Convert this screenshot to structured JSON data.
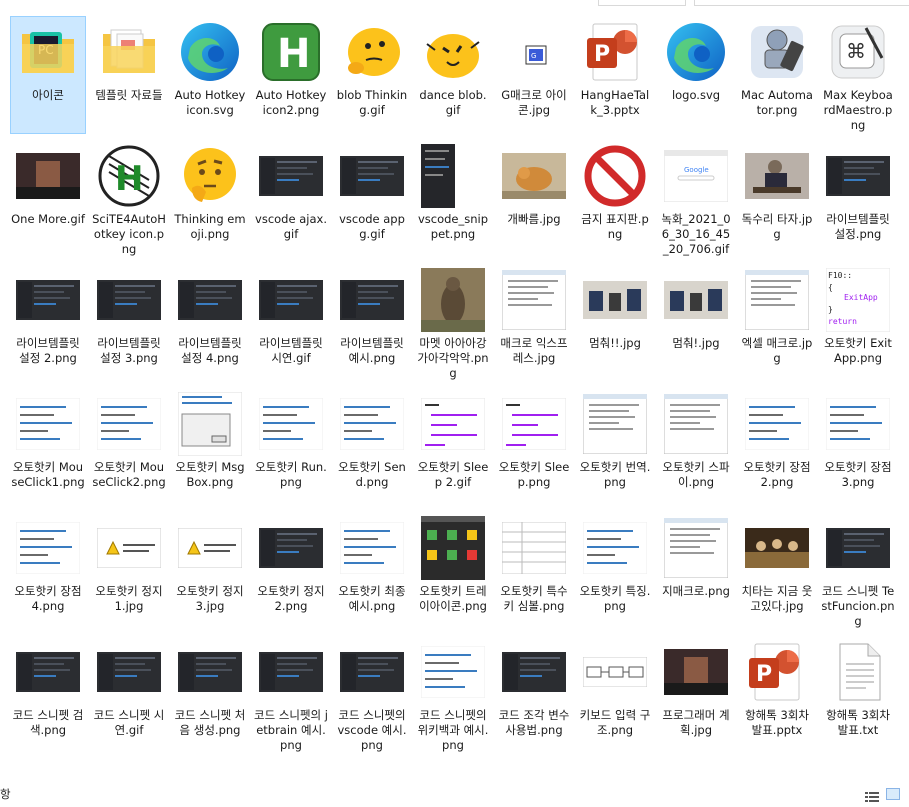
{
  "status": {
    "text": "항"
  },
  "files": [
    {
      "label": "아이콘",
      "icon": "folder-pc-icon",
      "selected": true
    },
    {
      "label": "템플릿 자료들",
      "icon": "folder-docs-icon"
    },
    {
      "label": "Auto Hotkey icon.svg",
      "icon": "edge-icon"
    },
    {
      "label": "Auto Hotkey icon2.png",
      "icon": "green-h-icon"
    },
    {
      "label": "blob Thinking.gif",
      "icon": "blob-thinking-icon"
    },
    {
      "label": "dance blob.gif",
      "icon": "blob-dance-icon"
    },
    {
      "label": "G매크로 아이콘.jpg",
      "icon": "small-app-icon"
    },
    {
      "label": "HangHaeTalk_3.pptx",
      "icon": "powerpoint-icon"
    },
    {
      "label": "logo.svg",
      "icon": "edge-icon"
    },
    {
      "label": "Mac Automator.png",
      "icon": "automator-robot-icon"
    },
    {
      "label": "Max KeyboardMaestro.png",
      "icon": "keyboard-maestro-icon"
    },
    {
      "label": "One More.gif",
      "icon": "photo-dark-icon"
    },
    {
      "label": "SciTE4AutoHotkey icon.png",
      "icon": "green-h-circle-icon"
    },
    {
      "label": "Thinking emoji.png",
      "icon": "thinking-emoji-icon"
    },
    {
      "label": "vscode ajax.gif",
      "icon": "screenshot-dark-icon"
    },
    {
      "label": "vscode appg.gif",
      "icon": "screenshot-dark-icon"
    },
    {
      "label": "vscode_snippet.png",
      "icon": "screenshot-menu-icon"
    },
    {
      "label": "개빠름.jpg",
      "icon": "photo-dog-icon"
    },
    {
      "label": "금지 표지판.png",
      "icon": "prohibited-sign-icon"
    },
    {
      "label": "녹화_2021_06_30_16_45_20_706.gif",
      "icon": "screenshot-browser-icon"
    },
    {
      "label": "독수리 타자.jpg",
      "icon": "photo-person-icon"
    },
    {
      "label": "라이브템플릿 설정.png",
      "icon": "screenshot-dark-icon"
    },
    {
      "label": "라이브템플릿 설정 2.png",
      "icon": "screenshot-dark-icon"
    },
    {
      "label": "라이브템플릿 설정 3.png",
      "icon": "screenshot-dark-icon"
    },
    {
      "label": "라이브템플릿 설정 4.png",
      "icon": "screenshot-dark-icon"
    },
    {
      "label": "라이브템플릿 시연.gif",
      "icon": "screenshot-dark-icon"
    },
    {
      "label": "라이브템플릿 예시.png",
      "icon": "screenshot-dark-icon"
    },
    {
      "label": "마멧 아아아강가아각악악.png",
      "icon": "photo-marmot-icon"
    },
    {
      "label": "매크로 익스프레스.jpg",
      "icon": "screenshot-window-icon"
    },
    {
      "label": "멈춰!!.jpg",
      "icon": "photo-class-icon"
    },
    {
      "label": "멈춰!.jpg",
      "icon": "photo-class-icon"
    },
    {
      "label": "엑셀 매크로.jpg",
      "icon": "screenshot-window-icon"
    },
    {
      "label": "오토핫키 ExitApp.png",
      "icon": "code-exitapp-icon"
    },
    {
      "label": "오토핫키 MouseClick1.png",
      "icon": "code-line-icon"
    },
    {
      "label": "오토핫키 MouseClick2.png",
      "icon": "code-line-icon"
    },
    {
      "label": "오토핫키 MsgBox.png",
      "icon": "msgbox-icon"
    },
    {
      "label": "오토핫키 Run.png",
      "icon": "code-line-icon"
    },
    {
      "label": "오토핫키 Send.png",
      "icon": "code-line-icon"
    },
    {
      "label": "오토핫키 Sleep 2.gif",
      "icon": "code-sleep-icon"
    },
    {
      "label": "오토핫키 Sleep.png",
      "icon": "code-sleep-icon"
    },
    {
      "label": "오토핫키 번역.png",
      "icon": "screenshot-window-icon"
    },
    {
      "label": "오토핫키 스파이.png",
      "icon": "screenshot-window-icon"
    },
    {
      "label": "오토핫키 장점2.png",
      "icon": "code-line-icon"
    },
    {
      "label": "오토핫키 장점3.png",
      "icon": "code-line-icon"
    },
    {
      "label": "오토핫키 장점4.png",
      "icon": "code-line-icon"
    },
    {
      "label": "오토핫키 정지 1.jpg",
      "icon": "warning-dialog-icon"
    },
    {
      "label": "오토핫키 정지 3.jpg",
      "icon": "warning-dialog-icon"
    },
    {
      "label": "오토핫키 정지2.png",
      "icon": "screenshot-dark-icon"
    },
    {
      "label": "오토핫키 최종 예시.png",
      "icon": "code-line-icon"
    },
    {
      "label": "오토핫키 트레이아이콘.png",
      "icon": "screenshot-tray-icon"
    },
    {
      "label": "오토핫키 특수키 심볼.png",
      "icon": "screenshot-table-icon"
    },
    {
      "label": "오토핫키 특징.png",
      "icon": "code-line-icon"
    },
    {
      "label": "지매크로.png",
      "icon": "screenshot-window-icon"
    },
    {
      "label": "치타는 지금 웃고있다.jpg",
      "icon": "photo-stage-icon"
    },
    {
      "label": "코드 스니펫 TestFuncion.png",
      "icon": "screenshot-dark-icon"
    },
    {
      "label": "코드 스니펫 검색.png",
      "icon": "screenshot-dark-icon"
    },
    {
      "label": "코드 스니펫 시연.gif",
      "icon": "screenshot-dark-icon"
    },
    {
      "label": "코드 스니펫 처음 생성.png",
      "icon": "screenshot-dark-icon"
    },
    {
      "label": "코드 스니펫의 jetbrain 예시.png",
      "icon": "screenshot-dark-icon"
    },
    {
      "label": "코드 스니펫의 vscode 예시.png",
      "icon": "screenshot-dark-icon"
    },
    {
      "label": "코드 스니펫의 위키백과 예시.png",
      "icon": "code-line-icon"
    },
    {
      "label": "코드 조각 변수 사용법.png",
      "icon": "screenshot-dark-icon"
    },
    {
      "label": "키보드 입력 구조.png",
      "icon": "diagram-icon"
    },
    {
      "label": "프로그래머 계획.jpg",
      "icon": "photo-dark-icon"
    },
    {
      "label": "항해톡 3회차 발표.pptx",
      "icon": "powerpoint-icon"
    },
    {
      "label": "항해톡 3회차 발표.txt",
      "icon": "text-file-icon"
    }
  ]
}
